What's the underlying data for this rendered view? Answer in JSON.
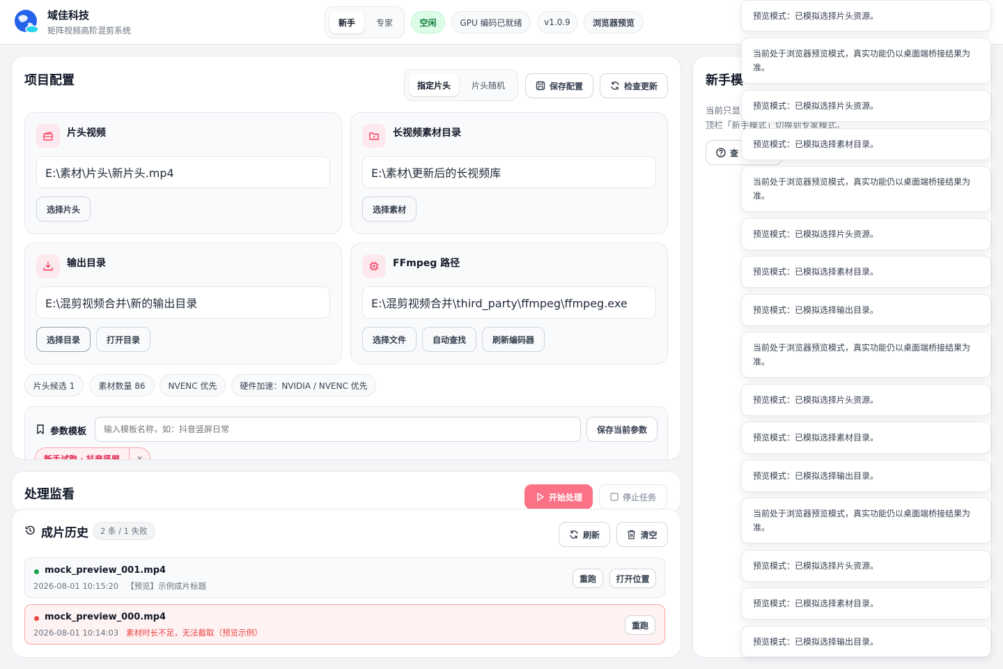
{
  "app": {
    "name": "域佳科技",
    "subtitle": "矩阵视频高阶混剪系统"
  },
  "header": {
    "modes": [
      "新手",
      "专家"
    ],
    "status_idle": "空闲",
    "gpu_status": "GPU 编码已就绪",
    "version": "v1.0.9",
    "preview_badge": "浏览器预览"
  },
  "project": {
    "title": "项目配置",
    "segment": [
      "指定片头",
      "片头随机"
    ],
    "save_label": "保存配置",
    "update_label": "检查更新",
    "cards": [
      {
        "title": "片头视频",
        "value": "E:\\素材\\片头\\新片头.mp4",
        "buttons": [
          "选择片头"
        ]
      },
      {
        "title": "长视频素材目录",
        "value": "E:\\素材\\更新后的长视频库",
        "buttons": [
          "选择素材"
        ]
      },
      {
        "title": "输出目录",
        "value": "E:\\混剪视频合并\\新的输出目录",
        "buttons": [
          "选择目录",
          "打开目录"
        ]
      },
      {
        "title": "FFmpeg 路径",
        "value": "E:\\混剪视频合并\\third_party\\ffmpeg\\ffmpeg.exe",
        "buttons": [
          "选择文件",
          "自动查找",
          "刷新编码器"
        ]
      }
    ],
    "chips": [
      "片头候选 1",
      "素材数量 86",
      "NVENC 优先",
      "硬件加速：NVIDIA / NVENC 优先"
    ],
    "template": {
      "label": "参数模板",
      "placeholder": "输入模板名称，如：抖音竖屏日常",
      "save_label": "保存当前参数",
      "saved": [
        "新手试跑 · 抖音竖屏"
      ]
    }
  },
  "monitor": {
    "title": "处理监看",
    "start_label": "开始处理",
    "stop_label": "停止任务"
  },
  "history": {
    "title": "成片历史",
    "badge": "2 条 / 1 失败",
    "refresh_label": "刷新",
    "clear_label": "清空",
    "items": [
      {
        "name": "mock_preview_001.mp4",
        "time": "2026-08-01 10:15:20",
        "note": "【预览】示例成片标题",
        "status": "success",
        "actions": [
          "重跑",
          "打开位置"
        ]
      },
      {
        "name": "mock_preview_000.mp4",
        "time": "2026-08-01 10:14:03",
        "note": "素材时长不足，无法截取（预览示例）",
        "status": "error",
        "actions": [
          "重跑"
        ]
      }
    ]
  },
  "guide": {
    "title_partial": "新手模",
    "line1_partial": "当前只显",
    "line2_partial": "顶栏「新手模式」切换到专家模式。",
    "button_partial": "查"
  },
  "toasts": [
    "预览模式：已模拟选择片头资源。",
    "当前处于浏览器预览模式，真实功能仍以桌面端桥接结果为准。",
    "预览模式：已模拟选择片头资源。",
    "预览模式：已模拟选择素材目录。",
    "当前处于浏览器预览模式，真实功能仍以桌面端桥接结果为准。",
    "预览模式：已模拟选择片头资源。",
    "预览模式：已模拟选择素材目录。",
    "预览模式：已模拟选择输出目录。",
    "当前处于浏览器预览模式，真实功能仍以桌面端桥接结果为准。",
    "预览模式：已模拟选择片头资源。",
    "预览模式：已模拟选择素材目录。",
    "预览模式：已模拟选择输出目录。",
    "当前处于浏览器预览模式，真实功能仍以桌面端桥接结果为准。",
    "预览模式：已模拟选择片头资源。",
    "预览模式：已模拟选择素材目录。",
    "预览模式：已模拟选择输出目录。"
  ],
  "colors": {
    "accent": "#f43f5e",
    "success": "#16a34a",
    "error": "#ef4444",
    "primary_btn": "#fb7185"
  }
}
